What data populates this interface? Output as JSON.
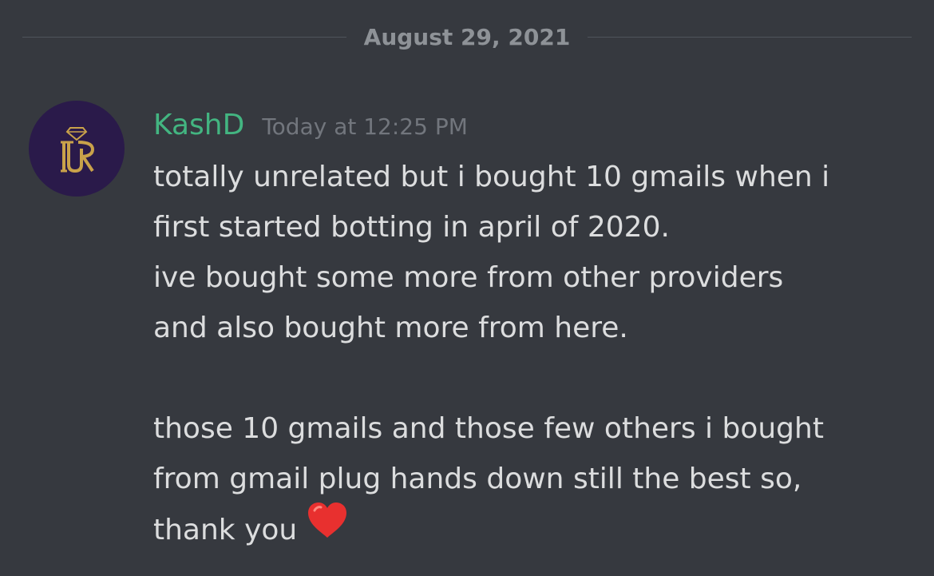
{
  "divider": {
    "date": "August 29, 2021"
  },
  "message": {
    "avatar_icon": "crown-monogram-logo",
    "username": "KashD",
    "timestamp": "Today at 12:25 PM",
    "lines": [
      "totally unrelated but i bought 10 gmails when i",
      "first started botting in april of 2020.",
      "ive bought some more from other providers",
      "and also bought more from here.",
      "",
      "those 10 gmails and those few others i bought",
      "from gmail plug hands down still the best so,",
      "thank you"
    ],
    "emoji": "red-heart-icon"
  },
  "colors": {
    "background": "#36393f",
    "username": "#43b581",
    "text": "#dcddde",
    "muted": "#72767d",
    "avatar_bg": "#2a1a4a",
    "gold": "#c9a24a",
    "heart": "#e8302f"
  }
}
